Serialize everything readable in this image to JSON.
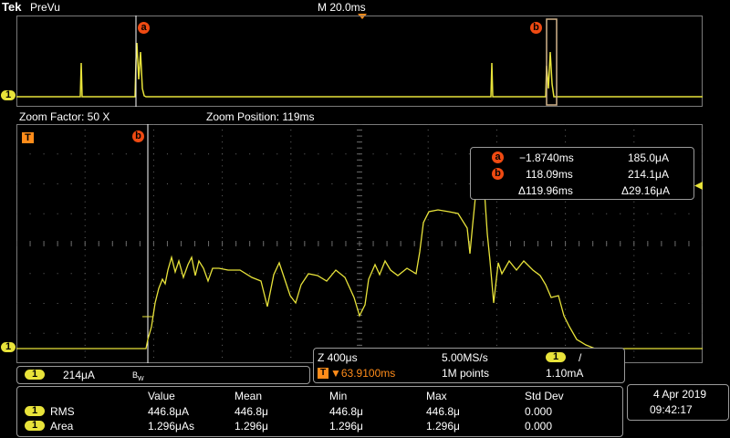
{
  "header": {
    "brand": "Tek",
    "mode": "PreVu",
    "timebase": "M 20.0ms"
  },
  "overview": {
    "cursor_a": "a",
    "cursor_b": "b",
    "channel_marker": "1"
  },
  "zoom_bar": {
    "factor": "Zoom Factor: 50 X",
    "position": "Zoom Position: 119ms"
  },
  "zoom": {
    "trigger_marker": "T",
    "cursor_b": "b",
    "channel_marker": "1"
  },
  "cursor_readout": {
    "a_label": "a",
    "a_time": "−1.8740ms",
    "a_value": "185.0μA",
    "b_label": "b",
    "b_time": "118.09ms",
    "b_value": "214.1μA",
    "delta_time": "Δ119.96ms",
    "delta_value": "Δ29.16μA"
  },
  "channel_scale": {
    "channel": "1",
    "scale": "214μA",
    "bw": "B",
    "bw_sub": "W"
  },
  "acquisition": {
    "zoom_scale": "Z 400μs",
    "sample_rate": "5.00MS/s",
    "trigger_channel": "1",
    "trigger_slope": "/",
    "trigger_icon": "T",
    "trigger_pos": "▼63.9100ms",
    "record_length": "1M points",
    "trigger_level": "1.10mA"
  },
  "measurements": {
    "headers": [
      "Value",
      "Mean",
      "Min",
      "Max",
      "Std Dev"
    ],
    "rows": [
      {
        "channel": "1",
        "name": "RMS",
        "cells": [
          "446.8μA",
          "446.8μ",
          "446.8μ",
          "446.8μ",
          "0.000"
        ]
      },
      {
        "channel": "1",
        "name": "Area",
        "cells": [
          "1.296μAs",
          "1.296μ",
          "1.296μ",
          "1.296μ",
          "0.000"
        ]
      }
    ]
  },
  "datetime": {
    "date": "4 Apr  2019",
    "time": "09:42:17"
  },
  "colors": {
    "trace": "#e8e33a",
    "grid": "#6a6a6a",
    "cursor": "#f04a12",
    "trigger": "#ff8c1a",
    "frame": "#9a9a9a"
  }
}
